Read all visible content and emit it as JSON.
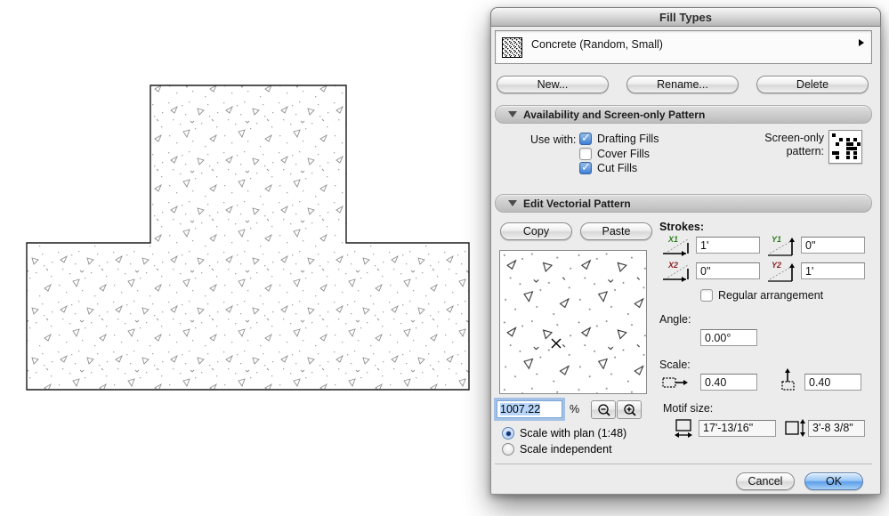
{
  "colors": {
    "accent_blue": "#5e9fe9",
    "stroke_label_green": "#2e7d1e",
    "stroke_label_red": "#8c1f1f",
    "selection_blue": "#b8d6fb"
  },
  "canvas": {
    "description": "T-shaped region filled with Concrete (Random, Small) vectorial pattern"
  },
  "window": {
    "title": "Fill Types"
  },
  "dialog": {
    "selector": {
      "value": "Concrete (Random, Small)",
      "thumb_icon": "concrete-pattern-thumbnail",
      "arrow_icon": "submenu-arrow"
    },
    "actions": {
      "new": "New...",
      "rename": "Rename...",
      "delete": "Delete"
    },
    "sections": {
      "availability": {
        "title": "Availability and Screen-only Pattern",
        "use_with_label": "Use with:",
        "checkboxes": [
          {
            "label": "Drafting Fills",
            "checked": true
          },
          {
            "label": "Cover Fills",
            "checked": false
          },
          {
            "label": "Cut Fills",
            "checked": true
          }
        ],
        "screen_only_line1": "Screen-only",
        "screen_only_line2": "pattern:",
        "screen_pattern_cells": [
          [
            0,
            0
          ],
          [
            1,
            2
          ],
          [
            1,
            4
          ],
          [
            1,
            6
          ],
          [
            2,
            1
          ],
          [
            2,
            4
          ],
          [
            2,
            5
          ],
          [
            3,
            4
          ],
          [
            3,
            5
          ],
          [
            3,
            6
          ],
          [
            4,
            0
          ],
          [
            4,
            1
          ],
          [
            4,
            4
          ],
          [
            4,
            6
          ],
          [
            5,
            1
          ],
          [
            5,
            4
          ],
          [
            2,
            7
          ],
          [
            5,
            6
          ]
        ]
      },
      "edit": {
        "title": "Edit Vectorial Pattern",
        "copy": "Copy",
        "paste": "Paste",
        "strokes_label": "Strokes:",
        "strokes": [
          {
            "name": "X1",
            "value": "1'"
          },
          {
            "name": "Y1",
            "value": "0\""
          },
          {
            "name": "X2",
            "value": "0\""
          },
          {
            "name": "Y2",
            "value": "1'"
          }
        ],
        "regular_arrangement": {
          "label": "Regular arrangement",
          "checked": false
        },
        "angle_label": "Angle:",
        "angle_value": "0.00°",
        "scale_label": "Scale:",
        "scale_x": "0.40",
        "scale_y": "0.40",
        "zoom_value": "1007.22",
        "percent": "%",
        "scale_radios": [
          {
            "label": "Scale with plan (1:48)",
            "selected": true
          },
          {
            "label": "Scale independent",
            "selected": false
          }
        ],
        "motif_label": "Motif size:",
        "motif_width": "17'-13/16\"",
        "motif_height": "3'-8 3/8\""
      }
    },
    "footer": {
      "cancel": "Cancel",
      "ok": "OK"
    }
  }
}
